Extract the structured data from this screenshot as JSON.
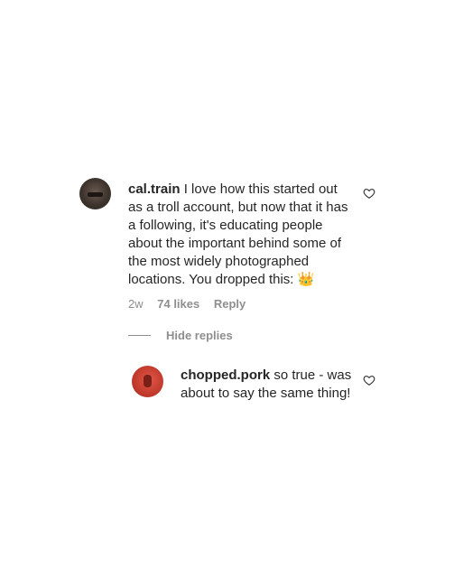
{
  "comment": {
    "username": "cal.train",
    "text": "I love how this started out as a troll account, but now that it has a following, it's educating people about the important behind some of the most widely photographed locations. You dropped this: 👑",
    "time": "2w",
    "likes": "74 likes",
    "reply_label": "Reply",
    "avatar_icon": "avatar-photo"
  },
  "replies_toggle": {
    "label": "Hide replies"
  },
  "reply": {
    "username": "chopped.pork",
    "text": "so true - was about to say the same thing!",
    "avatar_icon": "avatar-photo"
  },
  "icons": {
    "like": "heart-icon"
  }
}
